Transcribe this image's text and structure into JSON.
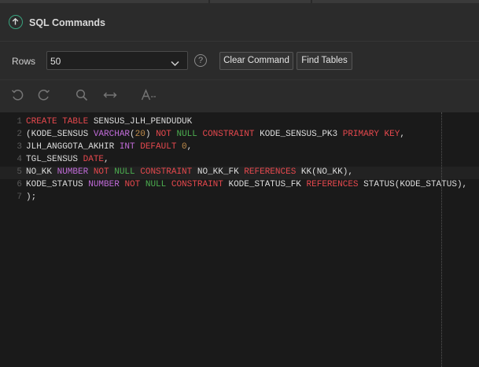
{
  "header": {
    "title": "SQL Commands"
  },
  "controls": {
    "rows_label": "Rows",
    "rows_value": "50",
    "help_symbol": "?",
    "clear_command_label": "Clear Command",
    "find_tables_label": "Find Tables"
  },
  "toolbar": {
    "icons": [
      "undo-icon",
      "redo-icon",
      "search-icon",
      "expand-icon",
      "font-size-icon"
    ]
  },
  "editor": {
    "line_numbers": [
      "1",
      "2",
      "3",
      "4",
      "5",
      "6",
      "7"
    ],
    "lines": [
      [
        {
          "t": "CREATE TABLE ",
          "c": "kw"
        },
        {
          "t": "SENSUS_JLH_PENDUDUK",
          "c": ""
        }
      ],
      [
        {
          "t": "(KODE_SENSUS ",
          "c": ""
        },
        {
          "t": "VARCHAR",
          "c": "ty"
        },
        {
          "t": "(",
          "c": ""
        },
        {
          "t": "20",
          "c": "nm"
        },
        {
          "t": ") ",
          "c": ""
        },
        {
          "t": "NOT ",
          "c": "kw"
        },
        {
          "t": "NULL ",
          "c": "gn"
        },
        {
          "t": "CONSTRAINT ",
          "c": "kw"
        },
        {
          "t": "KODE_SENSUS_PK3 ",
          "c": ""
        },
        {
          "t": "PRIMARY KEY",
          "c": "kw"
        },
        {
          "t": ",",
          "c": ""
        }
      ],
      [
        {
          "t": "JLH_ANGGOTA_AKHIR ",
          "c": ""
        },
        {
          "t": "INT ",
          "c": "ty"
        },
        {
          "t": "DEFAULT ",
          "c": "kw"
        },
        {
          "t": "0",
          "c": "nm"
        },
        {
          "t": ",",
          "c": ""
        }
      ],
      [
        {
          "t": "TGL_SENSUS ",
          "c": ""
        },
        {
          "t": "DATE",
          "c": "kw"
        },
        {
          "t": ",",
          "c": ""
        }
      ],
      [
        {
          "t": "NO_KK ",
          "c": ""
        },
        {
          "t": "NUMBER ",
          "c": "ty"
        },
        {
          "t": "NOT ",
          "c": "kw"
        },
        {
          "t": "NULL ",
          "c": "gn"
        },
        {
          "t": "CONSTRAINT ",
          "c": "kw"
        },
        {
          "t": "NO_KK_FK ",
          "c": ""
        },
        {
          "t": "REFERENCES ",
          "c": "kw"
        },
        {
          "t": "KK(NO_KK),",
          "c": ""
        }
      ],
      [
        {
          "t": "KODE_STATUS ",
          "c": ""
        },
        {
          "t": "NUMBER ",
          "c": "ty"
        },
        {
          "t": "NOT ",
          "c": "kw"
        },
        {
          "t": "NULL ",
          "c": "gn"
        },
        {
          "t": "CONSTRAINT ",
          "c": "kw"
        },
        {
          "t": "KODE_STATUS_FK ",
          "c": ""
        },
        {
          "t": "REFERENCES ",
          "c": "kw"
        },
        {
          "t": "STATUS(KODE_STATUS),",
          "c": ""
        }
      ],
      [
        {
          "t": ");",
          "c": ""
        }
      ]
    ],
    "highlighted_line": 5
  },
  "colors": {
    "keyword": "#e5484d",
    "type": "#c06bd8",
    "number": "#c08c4a",
    "null": "#4caf50",
    "accent": "#39a37e"
  }
}
